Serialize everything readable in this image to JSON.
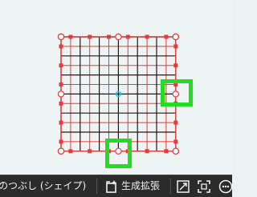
{
  "taskbar": {
    "fill_shape_label": "のつぶし (シェイプ)",
    "generative_expand_label": "生成拡張"
  },
  "icons": {
    "generative_expand": "generative-expand-icon",
    "crop": "crop-icon",
    "fit": "fit-to-frame-icon",
    "more": "more-icon"
  },
  "colors": {
    "grid_red": "#e83a3a",
    "grid_dark": "#2a1212",
    "center_cyan": "#22c8e0",
    "highlight_green": "#22dd22",
    "taskbar_bg": "#2b2b2b"
  }
}
